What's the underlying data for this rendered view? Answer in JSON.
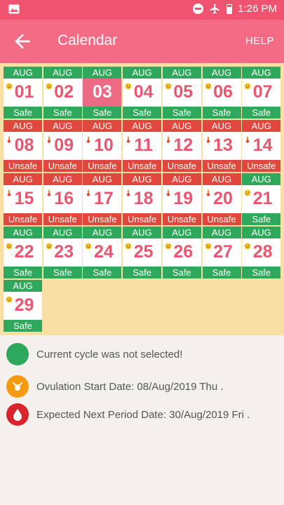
{
  "statusbar": {
    "time": "1:26 PM",
    "left_icon": "image-icon",
    "icons": [
      "dnd-icon",
      "airplane-icon",
      "battery-icon"
    ]
  },
  "appbar": {
    "title": "Calendar",
    "help_label": "HELP"
  },
  "colors": {
    "safe": "#2ea85a",
    "unsafe": "#e2473d",
    "today": "#ed6a84",
    "accent": "#f36b85",
    "grid_bg": "#f8e0a5"
  },
  "calendar": {
    "days": [
      {
        "month": "AUG",
        "day": "01",
        "status": "Safe"
      },
      {
        "month": "AUG",
        "day": "02",
        "status": "Safe"
      },
      {
        "month": "AUG",
        "day": "03",
        "status": "Safe",
        "today": true
      },
      {
        "month": "AUG",
        "day": "04",
        "status": "Safe"
      },
      {
        "month": "AUG",
        "day": "05",
        "status": "Safe"
      },
      {
        "month": "AUG",
        "day": "06",
        "status": "Safe"
      },
      {
        "month": "AUG",
        "day": "07",
        "status": "Safe"
      },
      {
        "month": "AUG",
        "day": "08",
        "status": "Unsafe"
      },
      {
        "month": "AUG",
        "day": "09",
        "status": "Unsafe"
      },
      {
        "month": "AUG",
        "day": "10",
        "status": "Unsafe"
      },
      {
        "month": "AUG",
        "day": "11",
        "status": "Unsafe"
      },
      {
        "month": "AUG",
        "day": "12",
        "status": "Unsafe"
      },
      {
        "month": "AUG",
        "day": "13",
        "status": "Unsafe"
      },
      {
        "month": "AUG",
        "day": "14",
        "status": "Unsafe"
      },
      {
        "month": "AUG",
        "day": "15",
        "status": "Unsafe"
      },
      {
        "month": "AUG",
        "day": "16",
        "status": "Unsafe"
      },
      {
        "month": "AUG",
        "day": "17",
        "status": "Unsafe"
      },
      {
        "month": "AUG",
        "day": "18",
        "status": "Unsafe"
      },
      {
        "month": "AUG",
        "day": "19",
        "status": "Unsafe"
      },
      {
        "month": "AUG",
        "day": "20",
        "status": "Unsafe"
      },
      {
        "month": "AUG",
        "day": "21",
        "status": "Safe"
      },
      {
        "month": "AUG",
        "day": "22",
        "status": "Safe"
      },
      {
        "month": "AUG",
        "day": "23",
        "status": "Safe"
      },
      {
        "month": "AUG",
        "day": "24",
        "status": "Safe"
      },
      {
        "month": "AUG",
        "day": "25",
        "status": "Safe"
      },
      {
        "month": "AUG",
        "day": "26",
        "status": "Safe"
      },
      {
        "month": "AUG",
        "day": "27",
        "status": "Safe"
      },
      {
        "month": "AUG",
        "day": "28",
        "status": "Safe"
      },
      {
        "month": "AUG",
        "day": "29",
        "status": "Safe"
      }
    ]
  },
  "legend": [
    {
      "icon": "green-circle-icon",
      "color": "#2ea85a",
      "text": "Current cycle was not selected!"
    },
    {
      "icon": "ovulation-icon",
      "color": "#f59a0e",
      "text": "Ovulation Start Date: 08/Aug/2019 Thu ."
    },
    {
      "icon": "blood-drop-icon",
      "color": "#d9232d",
      "text": "Expected Next Period Date: 30/Aug/2019 Fri ."
    }
  ]
}
